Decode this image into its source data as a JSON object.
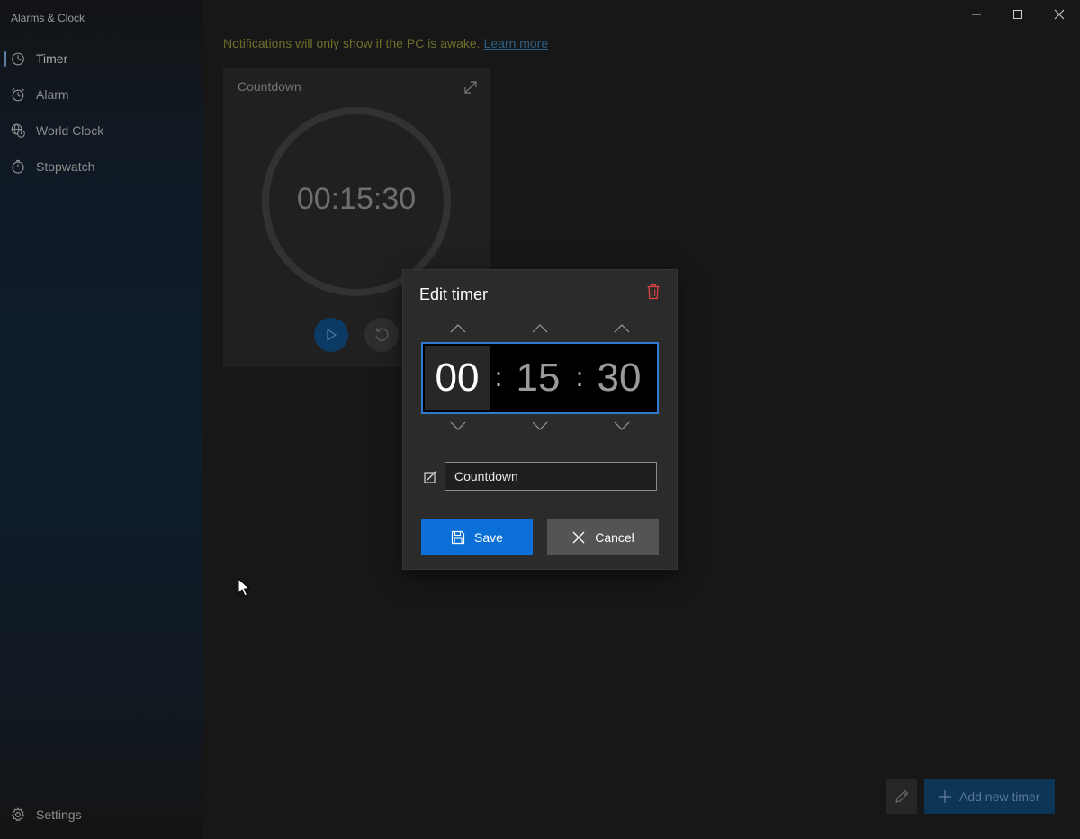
{
  "app": {
    "title": "Alarms & Clock"
  },
  "sidebar": {
    "items": [
      {
        "label": "Timer",
        "icon": "timer-icon",
        "active": true
      },
      {
        "label": "Alarm",
        "icon": "alarm-clock-icon",
        "active": false
      },
      {
        "label": "World Clock",
        "icon": "globe-clock-icon",
        "active": false
      },
      {
        "label": "Stopwatch",
        "icon": "stopwatch-icon",
        "active": false
      }
    ],
    "settings": {
      "label": "Settings",
      "icon": "gear-icon"
    }
  },
  "window_controls": [
    "minimize-icon",
    "maximize-icon",
    "close-icon"
  ],
  "notice": {
    "text": "Notifications will only show if the PC is awake.",
    "link": "Learn more"
  },
  "timer_card": {
    "title": "Countdown",
    "time": "00:15:30",
    "icons": [
      "expand-icon",
      "play-icon",
      "reset-icon"
    ]
  },
  "footer": {
    "add_label": "Add new timer",
    "icons": [
      "pencil-icon",
      "plus-icon"
    ]
  },
  "dialog": {
    "title": "Edit timer",
    "hours": "00",
    "minutes": "15",
    "seconds": "30",
    "separator": ":",
    "name_value": "Countdown",
    "save_label": "Save",
    "cancel_label": "Cancel",
    "icons": [
      "trash-icon",
      "chevron-up-icon",
      "chevron-down-icon",
      "edit-label-icon",
      "save-icon",
      "close-icon"
    ]
  },
  "colors": {
    "accent": "#0a6fd6",
    "picker_border": "#2f7bd1",
    "delete": "#e04545",
    "notice": "#6e6e2c",
    "link": "#2d5f84"
  }
}
